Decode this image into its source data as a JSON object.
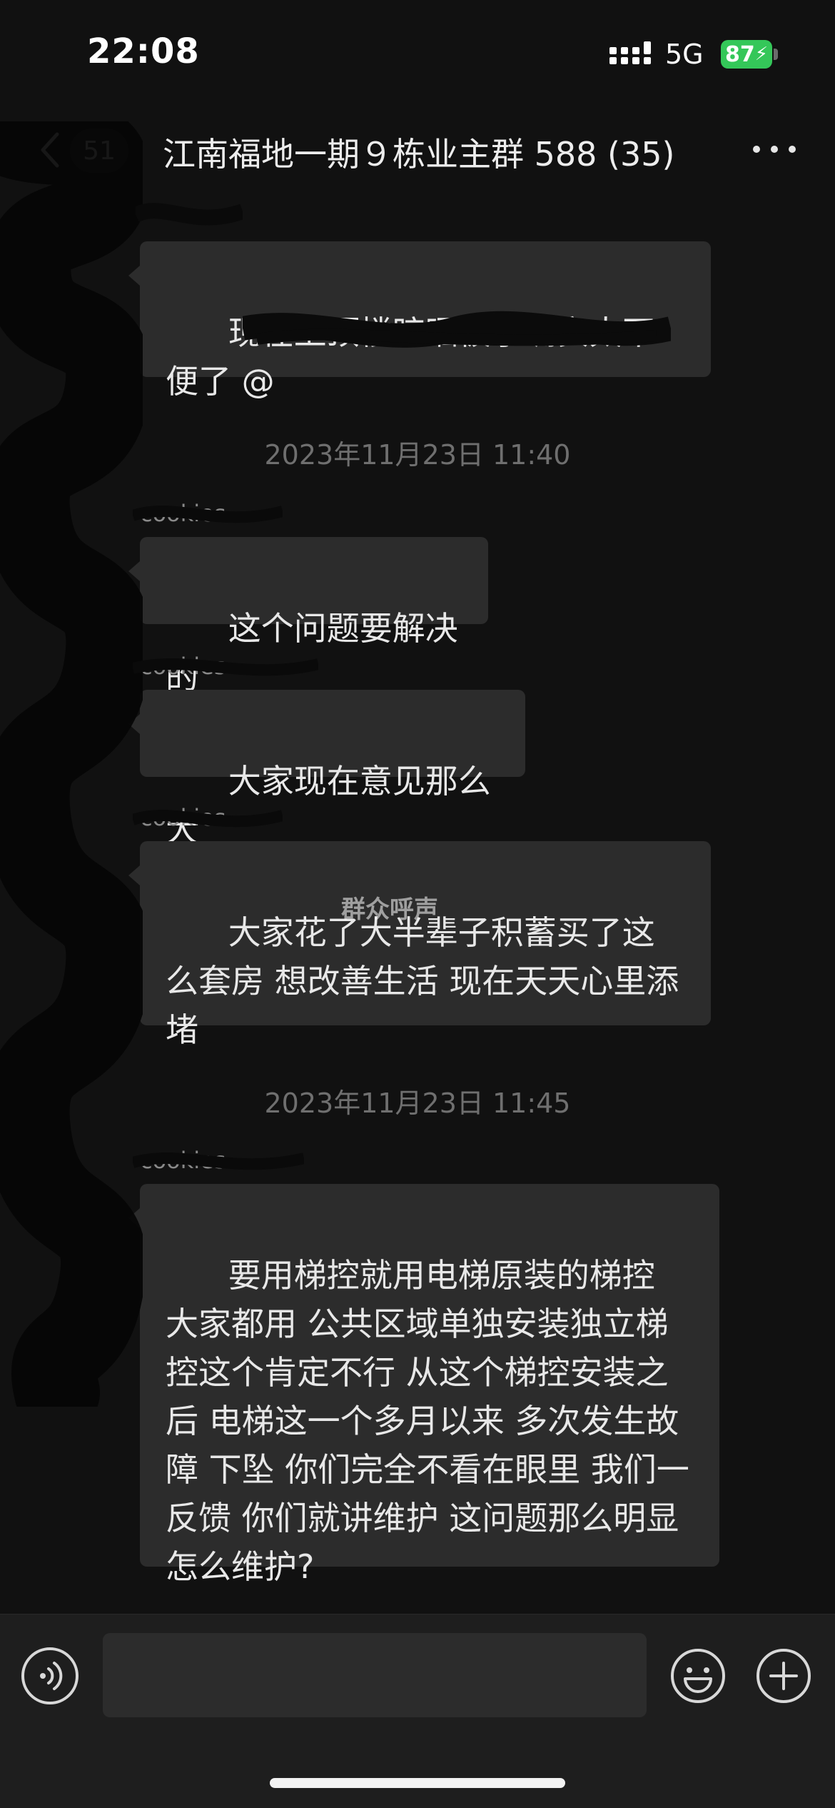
{
  "status_bar": {
    "time": "22:08",
    "network": "5G",
    "battery": "87"
  },
  "nav": {
    "unread_count": "51",
    "title": "江南福地一期９栋业主群 588 (35)"
  },
  "messages": [
    {
      "sender": "",
      "text": "现在上顶楼晾晒被子确实太不便了 @"
    },
    {
      "timestamp": "2023年11月23日 11:40"
    },
    {
      "sender": "cookies",
      "text": "这个问题要解决的"
    },
    {
      "sender": "cookies",
      "text": "大家现在意见那么大"
    },
    {
      "sender": "cookies",
      "text": "大家花了大半辈子积蓄买了这么套房 想改善生活 现在天天心里添堵"
    },
    {
      "timestamp": "2023年11月23日 11:45"
    },
    {
      "sender": "cookies",
      "text": "要用梯控就用电梯原装的梯控 大家都用 公共区域单独安装独立梯控这个肯定不行 从这个梯控安装之后 电梯这一个多月以来 多次发生故障 下坠 你们完全不看在眼里 我们一反馈 你们就讲维护 这问题那么明显 怎么维护?"
    }
  ],
  "watermark": "群众呼声",
  "input": {
    "placeholder": "",
    "value": ""
  },
  "colors": {
    "background": "#111111",
    "bubble": "#2c2c2c",
    "battery": "#34c759"
  }
}
